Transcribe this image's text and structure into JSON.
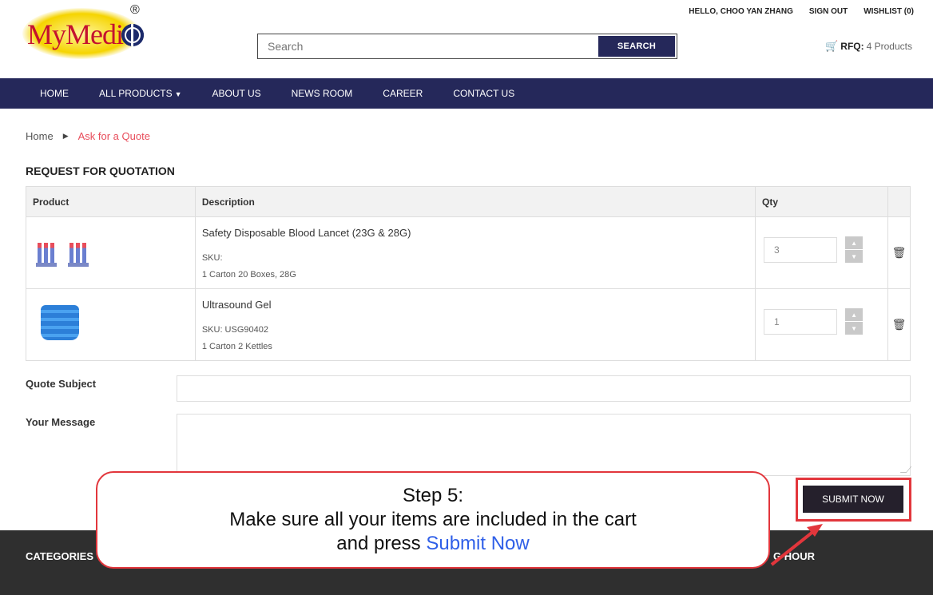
{
  "header": {
    "logo_text": "MyMedi",
    "logo_reg": "®",
    "search_placeholder": "Search",
    "search_button": "SEARCH",
    "greeting": "HELLO, CHOO YAN ZHANG",
    "sign_out": "SIGN OUT",
    "wishlist": "WISHLIST (0)",
    "rfq_label": "RFQ:",
    "rfq_count": "4 Products"
  },
  "nav": {
    "items": [
      "HOME",
      "ALL PRODUCTS",
      "ABOUT US",
      "NEWS ROOM",
      "CAREER",
      "CONTACT US"
    ]
  },
  "breadcrumb": {
    "home": "Home",
    "current": "Ask for a Quote"
  },
  "page_title": "REQUEST FOR QUOTATION",
  "table": {
    "headers": [
      "Product",
      "Description",
      "Qty"
    ],
    "rows": [
      {
        "title": "Safety Disposable Blood Lancet (23G & 28G)",
        "sku": "SKU:",
        "detail": "1 Carton 20 Boxes, 28G",
        "qty": "3"
      },
      {
        "title": "Ultrasound Gel",
        "sku": "SKU: USG90402",
        "detail": "1 Carton 2 Kettles",
        "qty": "1"
      }
    ]
  },
  "form": {
    "subject_label": "Quote Subject",
    "message_label": "Your Message",
    "submit": "SUBMIT NOW"
  },
  "footer": {
    "left": "CATEGORIES",
    "right": "G HOUR"
  },
  "callout": {
    "line1": "Step 5:",
    "line2": "Make sure all your items are included in the cart",
    "line3_prefix": "and press ",
    "line3_highlight": "Submit Now"
  },
  "colors": {
    "nav_bg": "#25285a",
    "accent_red": "#e84d5b",
    "callout_border": "#e2363c",
    "highlight_blue": "#2f5fe8"
  }
}
